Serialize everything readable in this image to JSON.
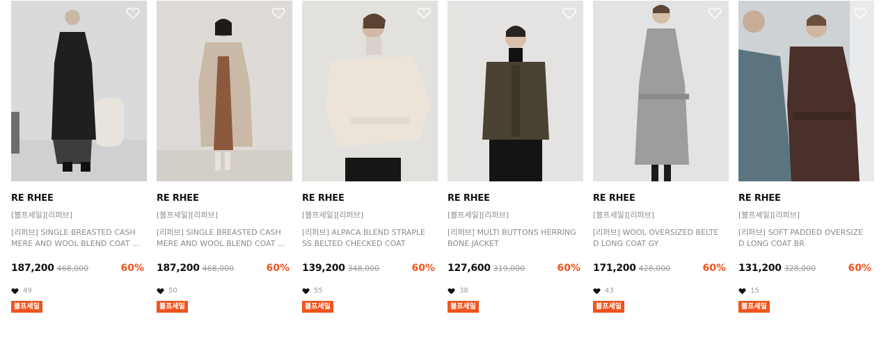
{
  "accent_color": "#f0541e",
  "products": [
    {
      "brand": "RE RHEE",
      "tagline": "[블프세일][리퍼브]",
      "name_line1": "[리퍼브] SINGLE BREASTED CASH",
      "name_line2": "MERE AND WOOL BLEND COAT ...",
      "price": "187,200",
      "original_price": "468,000",
      "discount": "60%",
      "likes": "49",
      "badge": "블프세일",
      "image_desc": "model in long black coat",
      "wish_icon": "heart-outline-icon"
    },
    {
      "brand": "RE RHEE",
      "tagline": "[블프세일][리퍼브]",
      "name_line1": "[리퍼브] SINGLE BREASTED CASH",
      "name_line2": "MERE AND WOOL BLEND COAT ...",
      "price": "187,200",
      "original_price": "468,000",
      "discount": "60%",
      "likes": "50",
      "badge": "블프세일",
      "image_desc": "model in long beige coat",
      "wish_icon": "heart-outline-icon"
    },
    {
      "brand": "RE RHEE",
      "tagline": "[블프세일][리퍼브]",
      "name_line1": "[리퍼브] ALPACA BLEND STRAPLE",
      "name_line2": "SS BELTED CHECKED COAT",
      "price": "139,200",
      "original_price": "348,000",
      "discount": "60%",
      "likes": "55",
      "badge": "블프세일",
      "image_desc": "model in cream belted coat",
      "wish_icon": "heart-outline-icon"
    },
    {
      "brand": "RE RHEE",
      "tagline": "[블프세일][리퍼브]",
      "name_line1": "[리퍼브] MULTI BUTTONS HERRING",
      "name_line2": "BONE JACKET",
      "price": "127,600",
      "original_price": "319,000",
      "discount": "60%",
      "likes": "38",
      "badge": "블프세일",
      "image_desc": "model in brown herringbone jacket",
      "wish_icon": "heart-outline-icon"
    },
    {
      "brand": "RE RHEE",
      "tagline": "[블프세일][리퍼브]",
      "name_line1": "[리퍼브] WOOL OVERSIZED BELTE",
      "name_line2": "D LONG COAT GY",
      "price": "171,200",
      "original_price": "428,000",
      "discount": "60%",
      "likes": "43",
      "badge": "블프세일",
      "image_desc": "model in grey belted long coat",
      "wish_icon": "heart-outline-icon"
    },
    {
      "brand": "RE RHEE",
      "tagline": "[블프세일][리퍼브]",
      "name_line1": "[리퍼브] SOFT PADDED OVERSIZE",
      "name_line2": "D LONG COAT BR",
      "price": "131,200",
      "original_price": "328,000",
      "discount": "60%",
      "likes": "15",
      "badge": "블프세일",
      "image_desc": "two models in padded coats",
      "wish_icon": "heart-outline-icon"
    }
  ]
}
